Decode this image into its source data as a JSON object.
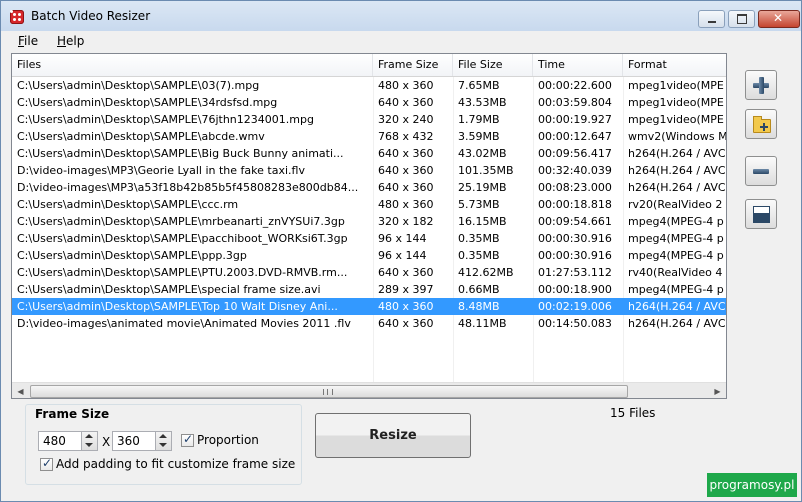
{
  "window": {
    "title": "Batch Video Resizer"
  },
  "menu": {
    "file": "File",
    "file_u": "F",
    "file_rest": "ile",
    "help_u": "H",
    "help_rest": "elp"
  },
  "columns": [
    "Files",
    "Frame Size",
    "File Size",
    "Time",
    "Format"
  ],
  "rows": [
    [
      "C:\\Users\\admin\\Desktop\\SAMPLE\\03(7).mpg",
      "480 x 360",
      "7.65MB",
      "00:00:22.600",
      "mpeg1video(MPE"
    ],
    [
      "C:\\Users\\admin\\Desktop\\SAMPLE\\34rdsfsd.mpg",
      "640 x 360",
      "43.53MB",
      "00:03:59.804",
      "mpeg1video(MPE"
    ],
    [
      "C:\\Users\\admin\\Desktop\\SAMPLE\\76jthn1234001.mpg",
      "320 x 240",
      "1.79MB",
      "00:00:19.927",
      "mpeg1video(MPE"
    ],
    [
      "C:\\Users\\admin\\Desktop\\SAMPLE\\abcde.wmv",
      "768 x 432",
      "3.59MB",
      "00:00:12.647",
      "wmv2(Windows M"
    ],
    [
      "C:\\Users\\admin\\Desktop\\SAMPLE\\Big Buck Bunny animati...",
      "640 x 360",
      "43.02MB",
      "00:09:56.417",
      "h264(H.264 / AVC"
    ],
    [
      "D:\\video-images\\MP3\\Georie Lyall in the fake taxi.flv",
      "640 x 360",
      "101.35MB",
      "00:32:40.039",
      "h264(H.264 / AVC"
    ],
    [
      "D:\\video-images\\MP3\\a53f18b42b85b5f45808283e800db84...",
      "640 x 360",
      "25.19MB",
      "00:08:23.000",
      "h264(H.264 / AVC"
    ],
    [
      "C:\\Users\\admin\\Desktop\\SAMPLE\\ccc.rm",
      "480 x 360",
      "5.73MB",
      "00:00:18.818",
      "rv20(RealVideo 2"
    ],
    [
      "C:\\Users\\admin\\Desktop\\SAMPLE\\mrbeanarti_znVYSUi7.3gp",
      "320 x 182",
      "16.15MB",
      "00:09:54.661",
      "mpeg4(MPEG-4 p"
    ],
    [
      "C:\\Users\\admin\\Desktop\\SAMPLE\\pacchiboot_WORKsi6T.3gp",
      "96 x 144",
      "0.35MB",
      "00:00:30.916",
      "mpeg4(MPEG-4 p"
    ],
    [
      "C:\\Users\\admin\\Desktop\\SAMPLE\\ppp.3gp",
      "96 x 144",
      "0.35MB",
      "00:00:30.916",
      "mpeg4(MPEG-4 p"
    ],
    [
      "C:\\Users\\admin\\Desktop\\SAMPLE\\PTU.2003.DVD-RMVB.rm...",
      "640 x 360",
      "412.62MB",
      "01:27:53.112",
      "rv40(RealVideo 4"
    ],
    [
      "C:\\Users\\admin\\Desktop\\SAMPLE\\special frame size.avi",
      "289 x 397",
      "0.66MB",
      "00:00:18.900",
      "mpeg4(MPEG-4 p"
    ],
    [
      "C:\\Users\\admin\\Desktop\\SAMPLE\\Top 10 Walt Disney Ani...",
      "480 x 360",
      "8.48MB",
      "00:02:19.006",
      "h264(H.264 / AVC"
    ],
    [
      "D:\\video-images\\animated movie\\Animated Movies 2011 .flv",
      "640 x 360",
      "48.11MB",
      "00:14:50.083",
      "h264(H.264 / AVC"
    ]
  ],
  "selected_row": 13,
  "frame_size": {
    "title": "Frame Size",
    "width": "480",
    "height": "360",
    "x": "X",
    "proportion_label": "Proportion",
    "proportion_checked": true,
    "padding_label": "Add padding to fit customize frame size",
    "padding_checked": true
  },
  "resize_label": "Resize",
  "file_count": "15 Files",
  "watermark": "programosy.pl",
  "colors": {
    "selection": "#3399ff",
    "title_bar": "#c8d9ee",
    "watermark": "#1ea84a"
  },
  "icons": [
    "add-file-icon",
    "add-folder-icon",
    "remove-icon",
    "clear-list-icon",
    "spin-up-icon",
    "spin-down-icon"
  ]
}
